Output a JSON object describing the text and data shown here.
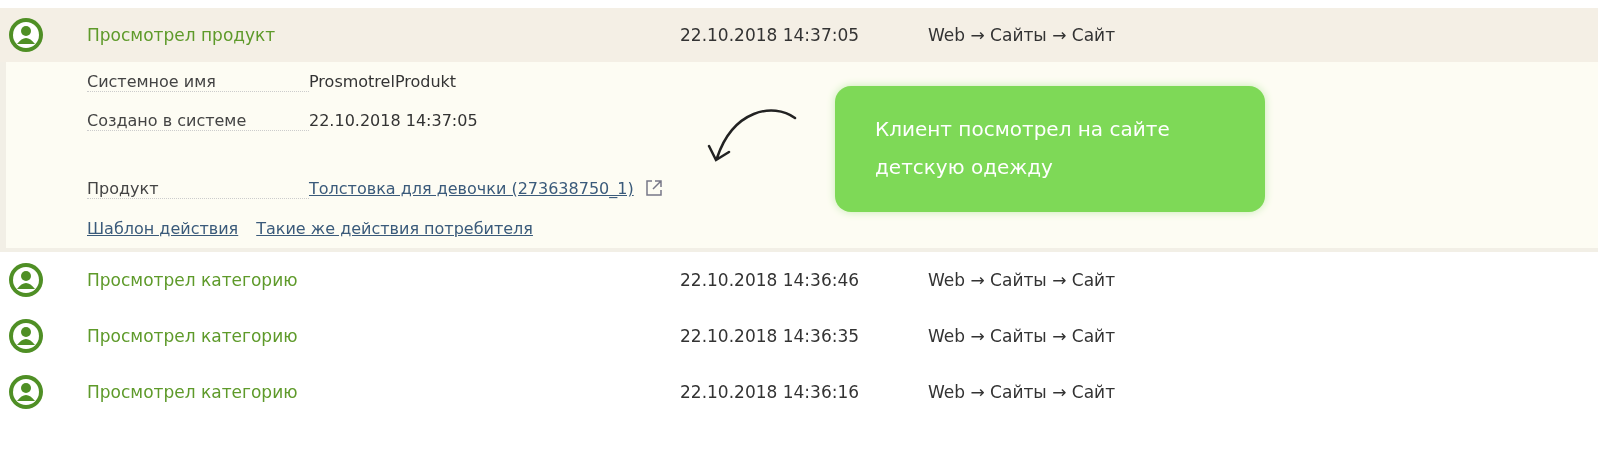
{
  "events": [
    {
      "title": "Просмотрел продукт",
      "time": "22.10.2018 14:37:05",
      "path": "Web → Сайты → Сайт",
      "expanded": true,
      "details": {
        "fields": [
          {
            "label": "Системное имя",
            "value": "ProsmotrelProdukt",
            "kind": "text"
          },
          {
            "label": "Создано в системе",
            "value": "22.10.2018 14:37:05",
            "kind": "text"
          },
          {
            "label": "Продукт",
            "value": "Толстовка для девочки (273638750_1)",
            "kind": "link"
          }
        ],
        "links": [
          "Шаблон действия",
          "Такие же действия потребителя"
        ],
        "callout": "Клиент посмотрел на сайте детскую одежду"
      }
    },
    {
      "title": "Просмотрел категорию",
      "time": "22.10.2018 14:36:46",
      "path": "Web → Сайты → Сайт",
      "expanded": false
    },
    {
      "title": "Просмотрел категорию",
      "time": "22.10.2018 14:36:35",
      "path": "Web → Сайты → Сайт",
      "expanded": false
    },
    {
      "title": "Просмотрел категорию",
      "time": "22.10.2018 14:36:16",
      "path": "Web → Сайты → Сайт",
      "expanded": false
    }
  ]
}
